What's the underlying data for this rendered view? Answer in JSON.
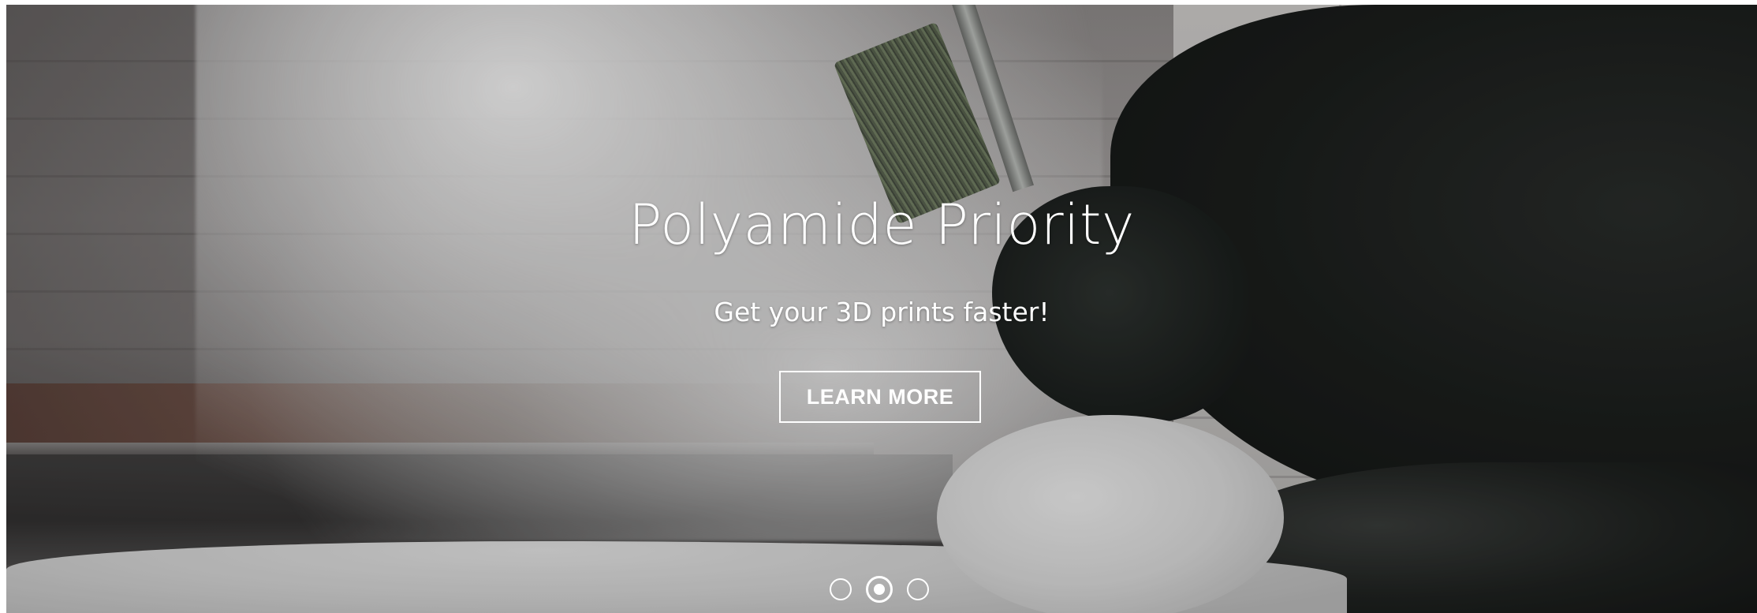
{
  "hero": {
    "title": "Polyamide Priority",
    "subtitle": "Get your 3D prints faster!",
    "cta_label": "LEARN MORE"
  },
  "carousel": {
    "slide_count": 3,
    "active_index": 1
  },
  "colors": {
    "text": "#ffffff",
    "button_border": "#ffffff"
  }
}
